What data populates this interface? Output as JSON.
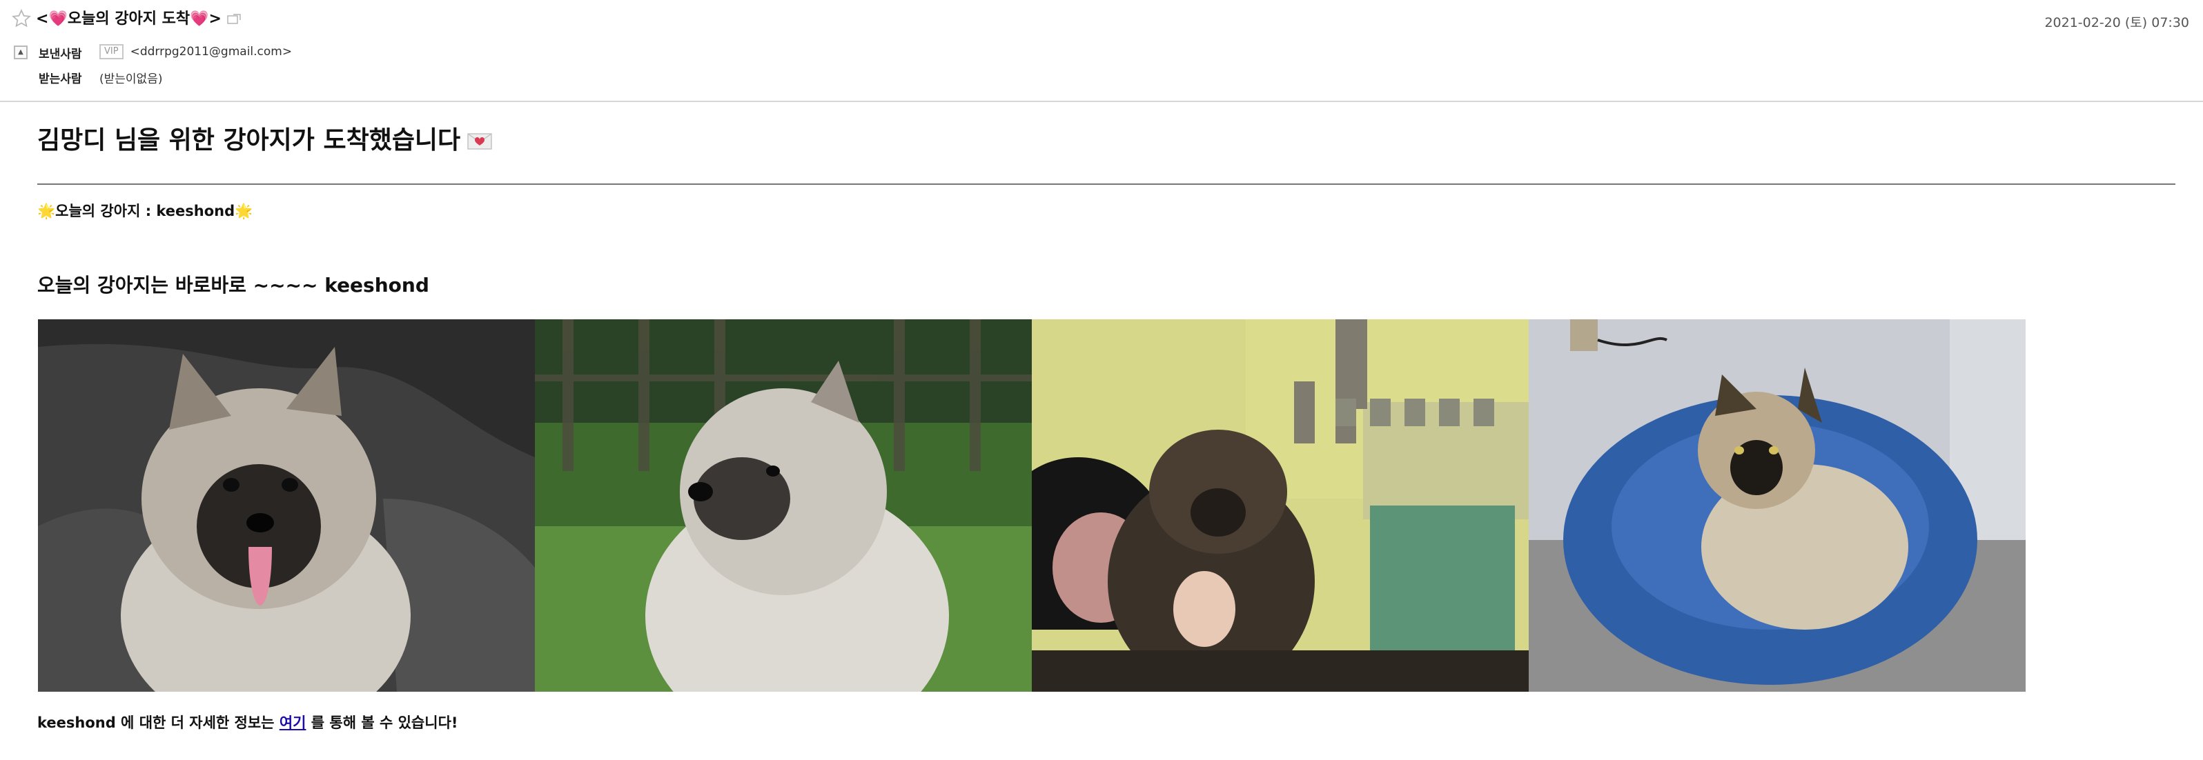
{
  "header": {
    "subject": {
      "prefix": "<",
      "left_emoji": "💗",
      "text": "오늘의 강아지 도착",
      "right_emoji": "💗",
      "suffix": ">"
    },
    "date": "2021-02-20 (토) 07:30",
    "sender_label": "보낸사람",
    "vip_badge": "VIP",
    "sender_email": "<ddrrpg2011@gmail.com>",
    "recipient_label": "받는사람",
    "recipient_value": "(받는이없음)",
    "icons": {
      "star": "star-icon",
      "subject": "open-window-icon",
      "toggle": "collapse-icon"
    }
  },
  "body": {
    "title": "김망디 님을 위한 강아지가 도착했습니다",
    "title_icon": "love-letter-icon",
    "today_dog": {
      "emoji": "🌟",
      "text": "오늘의 강아지 : keeshond"
    },
    "heading": "오늘의 강아지는 바로바로 ~~~~ keeshond",
    "photos": [
      "keeshond-photo-1",
      "keeshond-photo-2",
      "keeshond-photo-3",
      "keeshond-photo-4"
    ],
    "footer": {
      "prefix": "keeshond 에 대한 더 자세한 정보는 ",
      "link": "여기",
      "suffix": " 를 통해 볼 수 있습니다!"
    }
  },
  "colors": {
    "heart": "#e8388a",
    "link": "#1a0dab",
    "divider": "#777777",
    "star": "#f2b91e"
  }
}
